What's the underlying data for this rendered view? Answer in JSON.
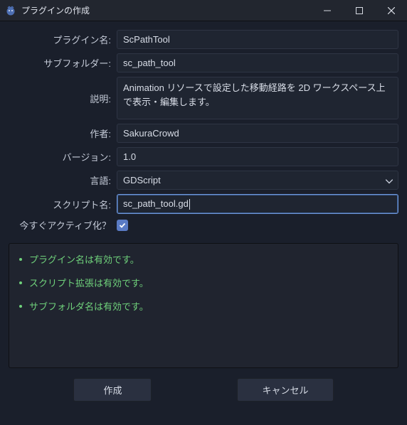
{
  "window": {
    "title": "プラグインの作成"
  },
  "form": {
    "plugin_name": {
      "label": "プラグイン名:",
      "value": "ScPathTool"
    },
    "subfolder": {
      "label": "サブフォルダー:",
      "value": "sc_path_tool"
    },
    "description": {
      "label": "説明:",
      "value": "Animation リソースで設定した移動経路を 2D ワークスペース上で表示・編集します。"
    },
    "author": {
      "label": "作者:",
      "value": "SakuraCrowd"
    },
    "version": {
      "label": "バージョン:",
      "value": "1.0"
    },
    "language": {
      "label": "言語:",
      "value": "GDScript"
    },
    "script_name": {
      "label": "スクリプト名:",
      "value": "sc_path_tool.gd"
    },
    "activate_now": {
      "label": "今すぐアクティブ化？",
      "checked": true
    }
  },
  "validation": {
    "items": [
      "プラグイン名は有効です。",
      "スクリプト拡張は有効です。",
      "サブフォルダ名は有効です。"
    ]
  },
  "buttons": {
    "create": "作成",
    "cancel": "キャンセル"
  }
}
